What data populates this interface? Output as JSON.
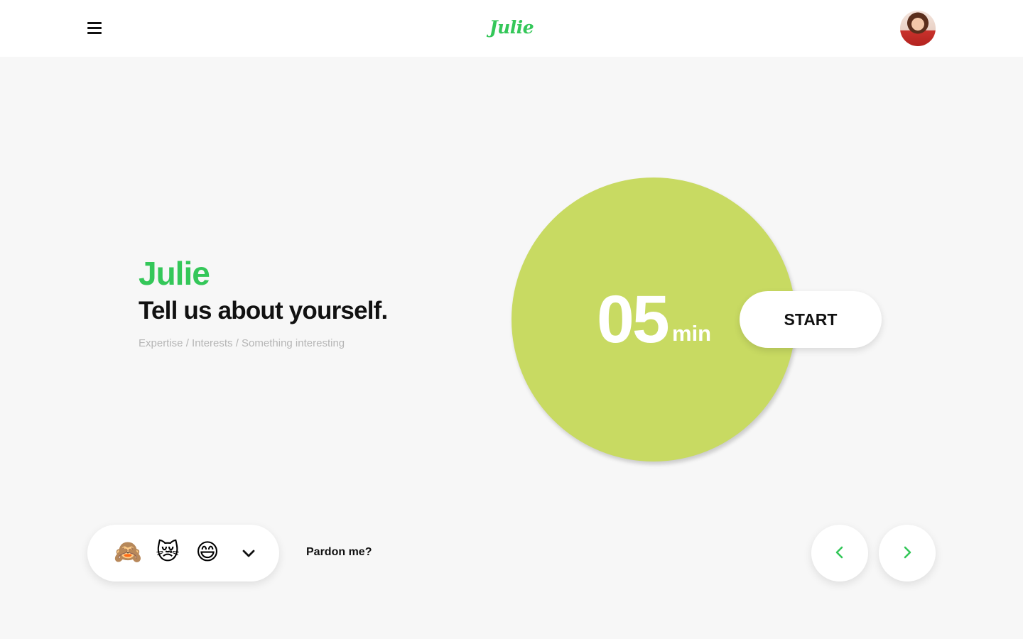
{
  "header": {
    "logo": "Julie",
    "menu_icon": "hamburger-menu-icon",
    "avatar_icon": "user-avatar"
  },
  "intro": {
    "name": "Julie",
    "title": "Tell us about yourself.",
    "hint": "Expertise / Interests / Something interesting"
  },
  "timer": {
    "value": "05",
    "unit": "min",
    "start_label": "START"
  },
  "reactions": {
    "items": [
      {
        "emoji": "🙈",
        "icon": "see-no-evil-monkey-icon"
      },
      {
        "emoji": "😿",
        "icon": "crying-cat-icon"
      },
      {
        "emoji": "😄",
        "icon": "grinning-face-icon"
      }
    ],
    "toggle_icon": "chevron-down-icon",
    "pardon_label": "Pardon me?"
  },
  "navigation": {
    "prev_icon": "chevron-left-icon",
    "next_icon": "chevron-right-icon"
  },
  "colors": {
    "accent": "#34c759",
    "timer": "#c8da62",
    "background": "#f7f7f7"
  }
}
